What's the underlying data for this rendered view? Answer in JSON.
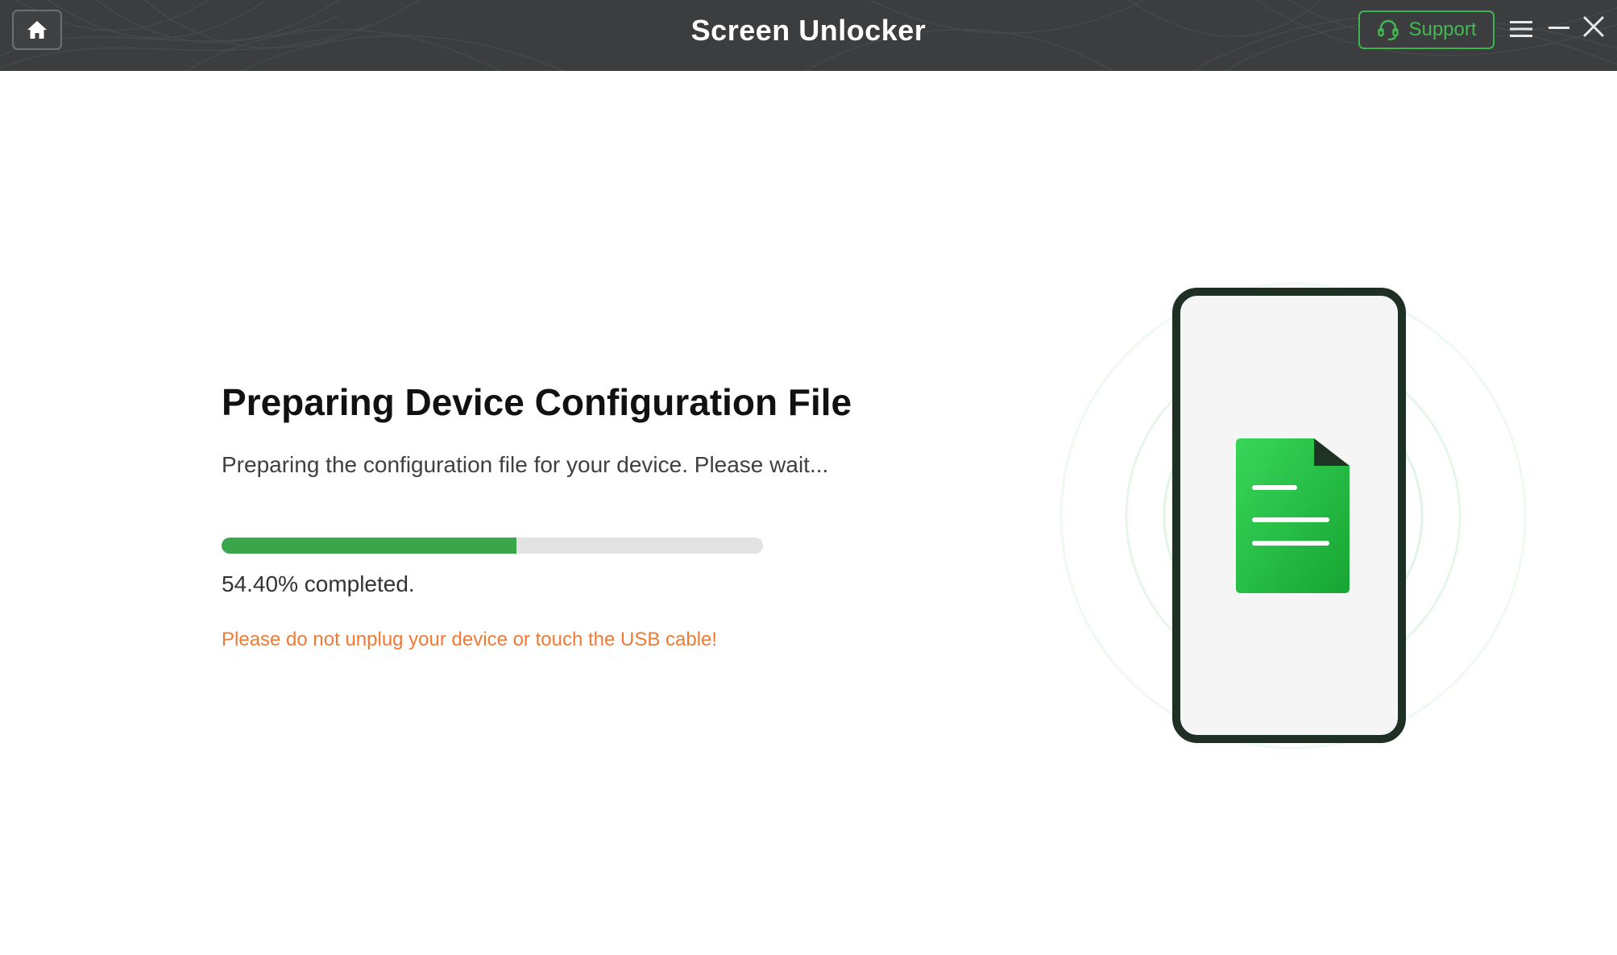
{
  "titlebar": {
    "app_title": "Screen Unlocker",
    "support_label": "Support",
    "home_icon": "home-icon",
    "menu_icon": "hamburger-menu-icon",
    "minimize_icon": "minimize-icon",
    "close_icon": "close-icon",
    "background_color": "#3b3d3e",
    "accent_color": "#3fb34f"
  },
  "main": {
    "title": "Preparing Device Configuration File",
    "subtitle": "Preparing the configuration file for your device. Please wait...",
    "progress": {
      "percent": 54.4,
      "label": "54.40% completed.",
      "fill_color": "#3aa54a",
      "track_color": "#e3e3e3"
    },
    "warning": "Please do not unplug your device or touch the USB cable!",
    "warning_color": "#f07a33"
  },
  "illustration": {
    "phone_icon": "phone-icon",
    "document_icon": "document-icon",
    "document_color": "#2cc24a"
  }
}
